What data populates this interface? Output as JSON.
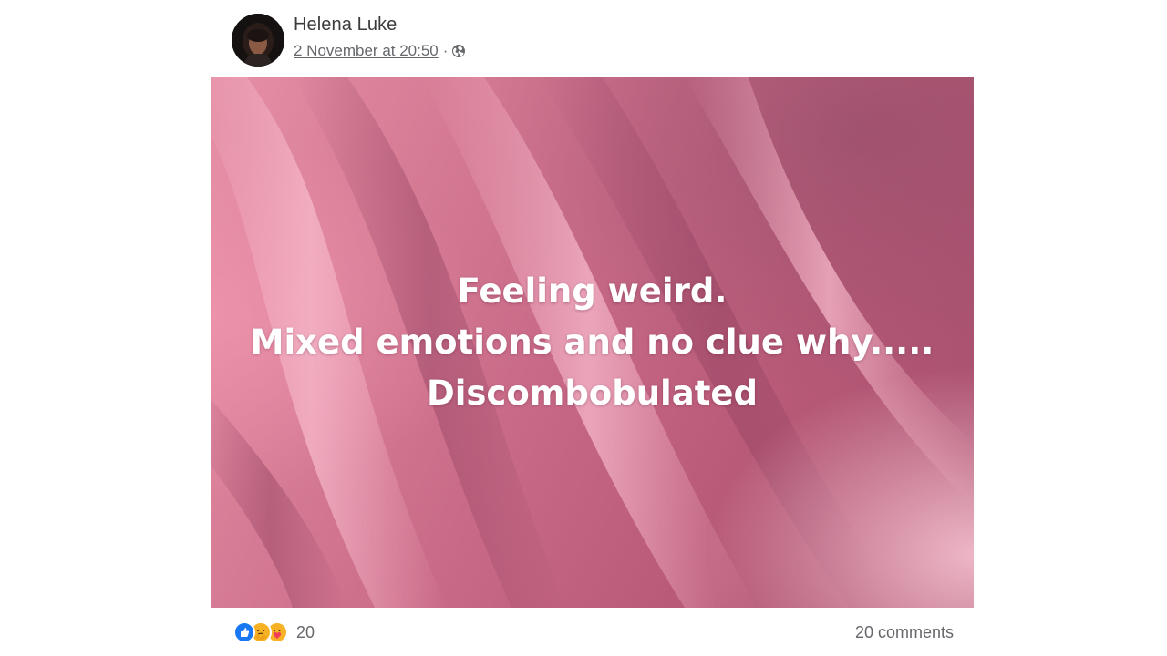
{
  "post": {
    "author": "Helena Luke",
    "timestamp": "2 November at 20:50",
    "separator": "·",
    "audience_icon": "globe-icon",
    "image_text_lines": [
      "Feeling weird.",
      "Mixed emotions and no clue why.....",
      "Discombobulated"
    ],
    "reactions": {
      "icons": [
        "like-icon",
        "care-icon",
        "love-icon"
      ],
      "count": "20"
    },
    "comments_label": "20 comments"
  },
  "colors": {
    "like": "#1877f2",
    "care": "#f7b125",
    "love": "#f33e58",
    "meta_text": "#65676b"
  }
}
